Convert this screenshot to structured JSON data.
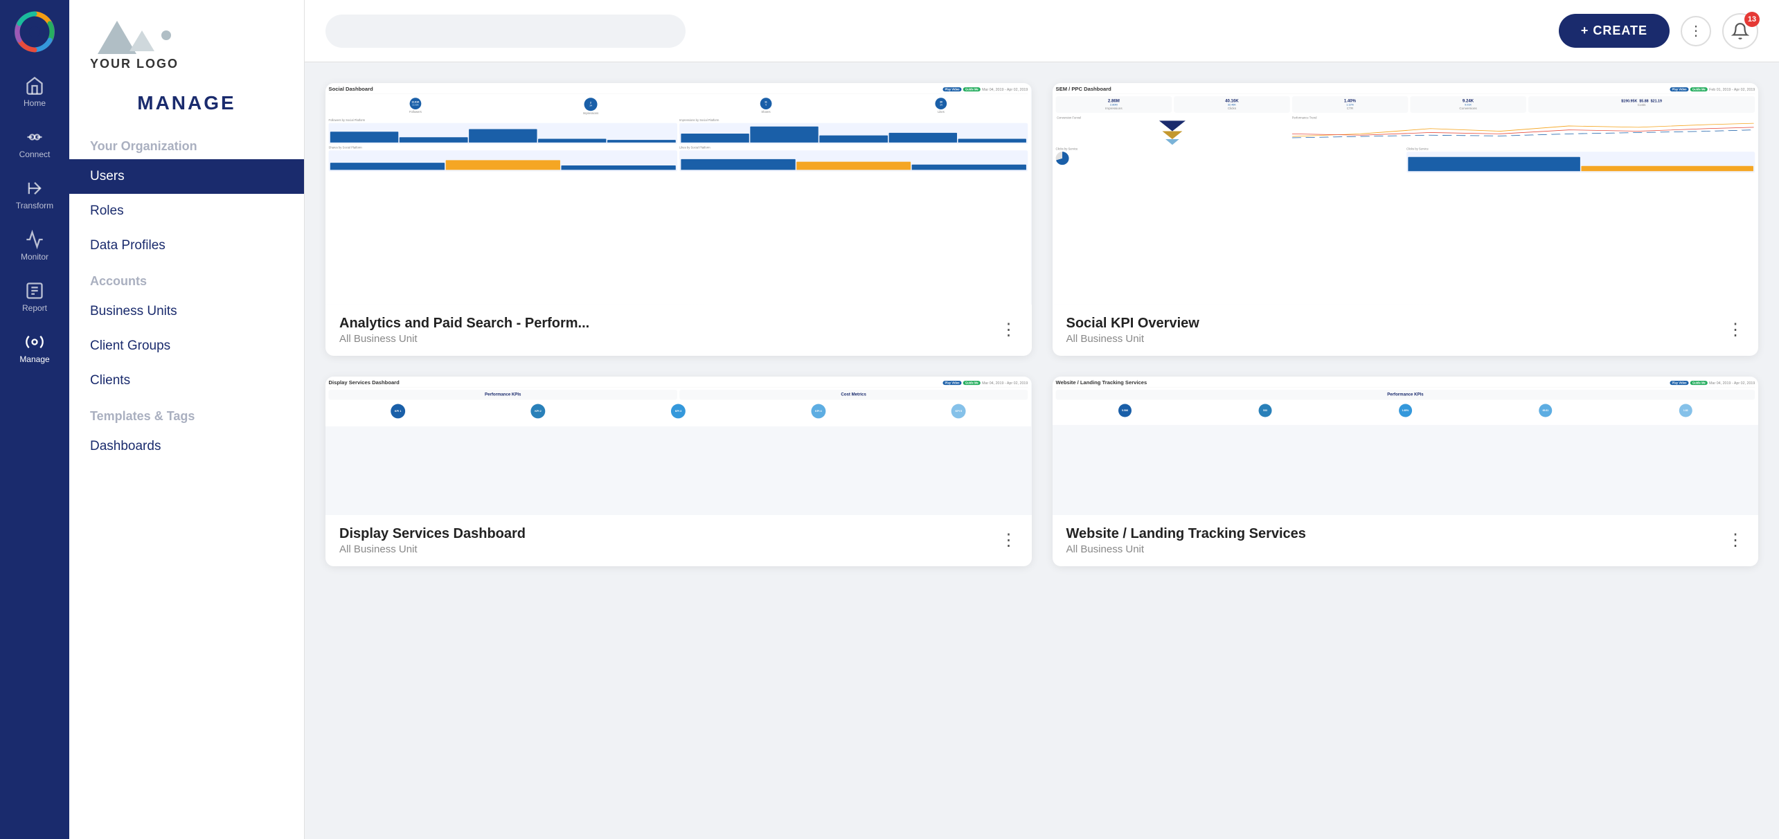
{
  "app": {
    "title": "Manage"
  },
  "logo": {
    "text": "YOUR LOGO"
  },
  "sidebar": {
    "manage_label": "MANAGE",
    "sections": [
      {
        "label": "Your Organization",
        "items": [
          {
            "id": "users",
            "label": "Users",
            "active": true
          },
          {
            "id": "roles",
            "label": "Roles",
            "active": false
          },
          {
            "id": "data-profiles",
            "label": "Data Profiles",
            "active": false
          }
        ]
      },
      {
        "label": "Accounts",
        "items": [
          {
            "id": "business-units",
            "label": "Business Units",
            "active": false
          },
          {
            "id": "client-groups",
            "label": "Client Groups",
            "active": false
          },
          {
            "id": "clients",
            "label": "Clients",
            "active": false
          }
        ]
      },
      {
        "label": "Templates & Tags",
        "items": [
          {
            "id": "dashboards",
            "label": "Dashboards",
            "active": false
          }
        ]
      }
    ]
  },
  "nav": {
    "items": [
      {
        "id": "home",
        "label": "Home",
        "active": false
      },
      {
        "id": "connect",
        "label": "Connect",
        "active": false
      },
      {
        "id": "transform",
        "label": "Transform",
        "active": false
      },
      {
        "id": "monitor",
        "label": "Monitor",
        "active": false
      },
      {
        "id": "report",
        "label": "Report",
        "active": false
      },
      {
        "id": "manage",
        "label": "Manage",
        "active": true
      }
    ]
  },
  "topbar": {
    "search_placeholder": "",
    "create_label": "+ CREATE",
    "notification_count": "13"
  },
  "cards": [
    {
      "id": "analytics-paid-search",
      "title": "Analytics and Paid Search - Perform...",
      "subtitle": "All Business Unit",
      "preview_type": "social",
      "dashboard_name": "Social Dashboard",
      "date_range": "Mar 04, 2019 - Apr 02, 2019"
    },
    {
      "id": "social-kpi",
      "title": "Social KPI Overview",
      "subtitle": "All Business Unit",
      "preview_type": "sem",
      "dashboard_name": "SEM / PPC Dashboard",
      "date_range": "Feb 01, 2019 - Apr 02, 2019"
    },
    {
      "id": "display-services",
      "title": "Display Services Dashboard",
      "subtitle": "All Business Unit",
      "preview_type": "display",
      "dashboard_name": "Display Services Dashboard",
      "date_range": "Mar 04, 2019 - Apr 02, 2019"
    },
    {
      "id": "website-landing",
      "title": "Website / Landing Tracking Services",
      "subtitle": "All Business Unit",
      "preview_type": "website",
      "dashboard_name": "Website / Landing Tracking Services",
      "date_range": "Mar 04, 2019 - Apr 02, 2019"
    }
  ]
}
